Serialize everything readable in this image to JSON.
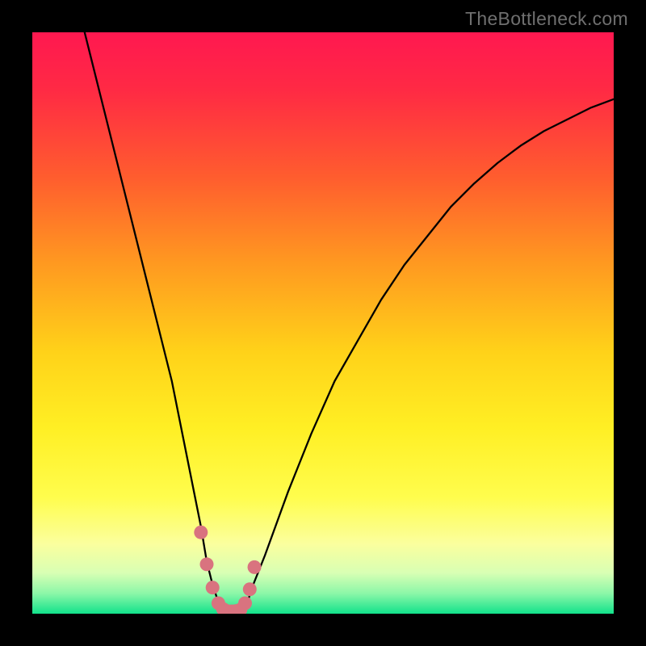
{
  "watermark": "TheBottleneck.com",
  "colors": {
    "background_black": "#000000",
    "watermark_gray": "#6f6f6f",
    "curve_black": "#000000",
    "marker_stroke": "#db6c76",
    "marker_fill": "#d9737f",
    "gradient_stops": [
      {
        "offset": 0.0,
        "color": "#ff1850"
      },
      {
        "offset": 0.1,
        "color": "#ff2a44"
      },
      {
        "offset": 0.25,
        "color": "#ff5d2e"
      },
      {
        "offset": 0.4,
        "color": "#ff9a20"
      },
      {
        "offset": 0.55,
        "color": "#ffd219"
      },
      {
        "offset": 0.68,
        "color": "#ffef24"
      },
      {
        "offset": 0.8,
        "color": "#fffd4d"
      },
      {
        "offset": 0.88,
        "color": "#fbff9e"
      },
      {
        "offset": 0.93,
        "color": "#d8ffb4"
      },
      {
        "offset": 0.965,
        "color": "#8cf7a8"
      },
      {
        "offset": 1.0,
        "color": "#12e28b"
      }
    ]
  },
  "chart_data": {
    "type": "line",
    "title": "",
    "xlabel": "",
    "ylabel": "",
    "xlim": [
      0,
      100
    ],
    "ylim": [
      0,
      100
    ],
    "x": [
      9,
      10,
      12,
      14,
      16,
      18,
      20,
      22,
      24,
      26,
      27,
      28,
      29,
      30,
      31,
      32,
      33,
      33.5,
      34,
      35,
      36,
      37,
      38,
      40,
      44,
      48,
      52,
      56,
      60,
      64,
      68,
      72,
      76,
      80,
      84,
      88,
      92,
      96,
      100
    ],
    "values": [
      100,
      96,
      88,
      80,
      72,
      64,
      56,
      48,
      40,
      30,
      25,
      20,
      15,
      9,
      5,
      2,
      0.6,
      0.4,
      0.5,
      0.4,
      0.6,
      2,
      5,
      10,
      21,
      31,
      40,
      47,
      54,
      60,
      65,
      70,
      74,
      77.5,
      80.5,
      83,
      85,
      87,
      88.5
    ],
    "marker_points_x": [
      29,
      30,
      31,
      32,
      32.8,
      33.5,
      34.3,
      35,
      35.8,
      36.6,
      37.4,
      38.2
    ],
    "marker_points_y": [
      14,
      8.5,
      4.5,
      1.8,
      0.8,
      0.45,
      0.4,
      0.45,
      0.7,
      1.8,
      4.2,
      8.0
    ],
    "annotations": []
  }
}
